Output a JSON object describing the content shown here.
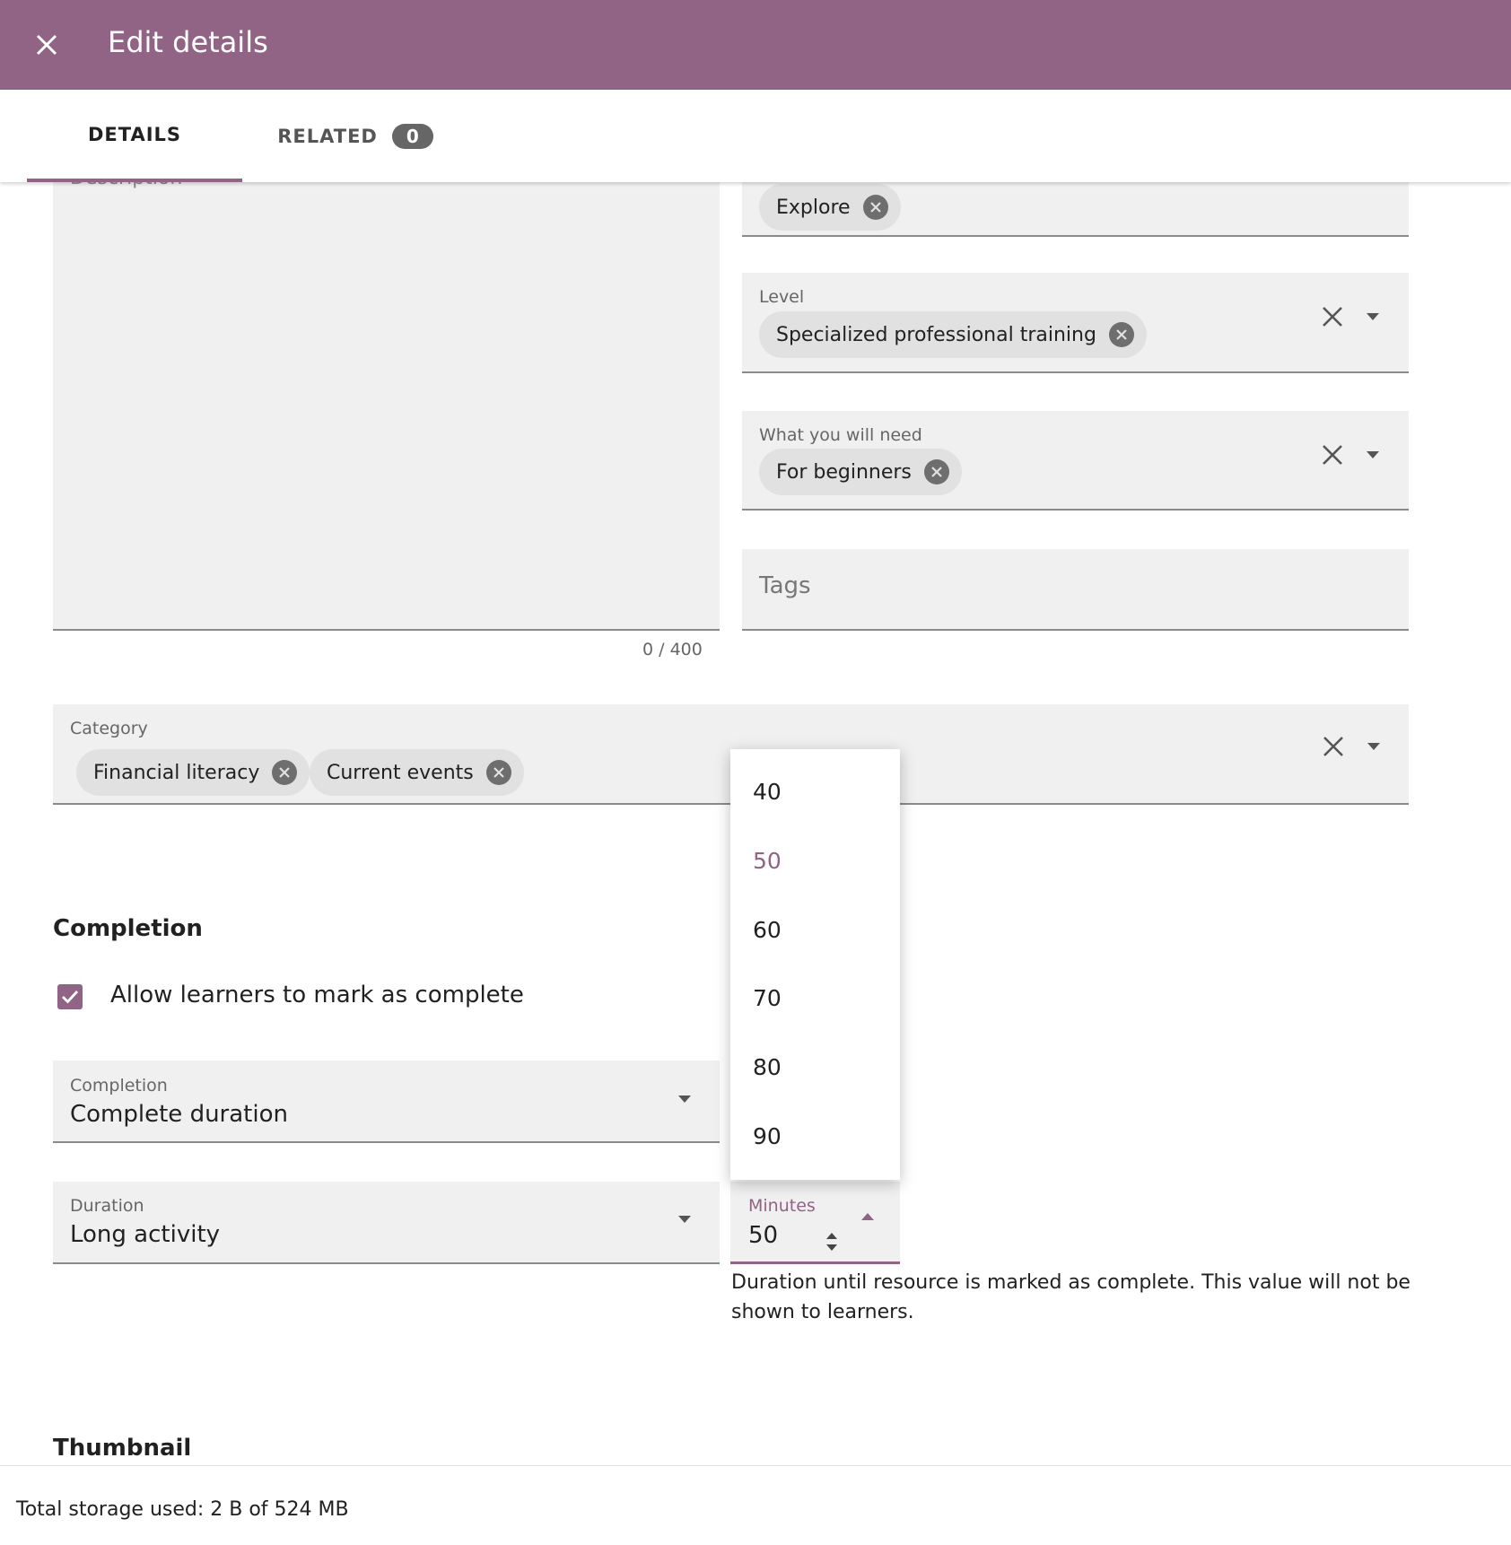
{
  "header": {
    "title": "Edit details",
    "close_icon": "close-icon"
  },
  "tabs": {
    "details": "DETAILS",
    "related": "RELATED",
    "related_count": "0"
  },
  "description": {
    "label": "Description",
    "counter": "0 / 400"
  },
  "learning_activity": {
    "chips": [
      "Explore"
    ]
  },
  "level": {
    "label": "Level",
    "chips": [
      "Specialized professional training"
    ]
  },
  "resources_needed": {
    "label": "What you will need",
    "chips": [
      "For beginners"
    ]
  },
  "tags": {
    "placeholder": "Tags"
  },
  "category": {
    "label": "Category",
    "chips": [
      "Financial literacy",
      "Current events"
    ]
  },
  "completion_section": {
    "title": "Completion",
    "checkbox_label": "Allow learners to mark as complete",
    "checkbox_checked": true,
    "completion_label": "Completion",
    "completion_value": "Complete duration",
    "duration_label": "Duration",
    "duration_value": "Long activity",
    "minutes_label": "Minutes",
    "minutes_value": "50",
    "helper_text": "Duration until resource is marked as complete. This value will not be shown to learners."
  },
  "minutes_menu": {
    "options": [
      "40",
      "50",
      "60",
      "70",
      "80",
      "90"
    ],
    "selected": "50"
  },
  "thumbnail": {
    "title": "Thumbnail"
  },
  "footer": {
    "storage_text": "Total storage used: 2 B of 524 MB"
  },
  "colors": {
    "brand": "#916385",
    "field_bg": "#f0f0f0",
    "chip_bg": "#e1e1e1"
  }
}
